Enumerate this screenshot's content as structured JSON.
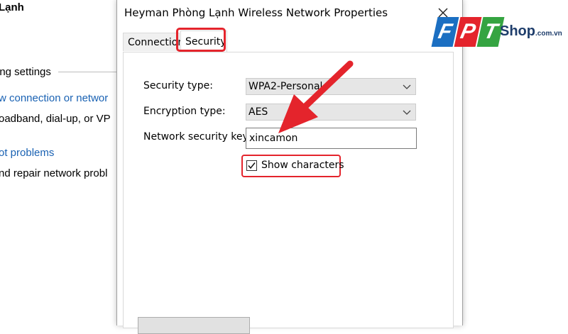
{
  "background_window": {
    "title": "Lạnh",
    "section_heading": "ing settings",
    "link1": "w connection or networ",
    "desc1": "oadband, dial-up, or VP",
    "link2": "ot problems",
    "desc2": "nd repair network probl"
  },
  "dialog": {
    "title": "Heyman Phòng Lạnh Wireless Network Properties",
    "tabs": [
      {
        "label": "Connection",
        "selected": false
      },
      {
        "label": "Security",
        "selected": true
      }
    ],
    "fields": {
      "security_type": {
        "label": "Security type:",
        "value": "WPA2-Personal"
      },
      "encryption_type": {
        "label": "Encryption type:",
        "value": "AES"
      },
      "network_key": {
        "label": "Network security key",
        "value": "xincamon"
      }
    },
    "show_characters": {
      "label": "Show characters",
      "checked": true
    }
  },
  "logo": {
    "letters": [
      "F",
      "P",
      "T"
    ],
    "shop": "Shop",
    "domain": ".com.vn",
    "colors": {
      "f": "#1b6fc2",
      "p": "#e4242c",
      "t": "#35a441",
      "shop_text": "#1e3d6b"
    }
  },
  "annotation": {
    "highlight_color": "#e4242c"
  }
}
